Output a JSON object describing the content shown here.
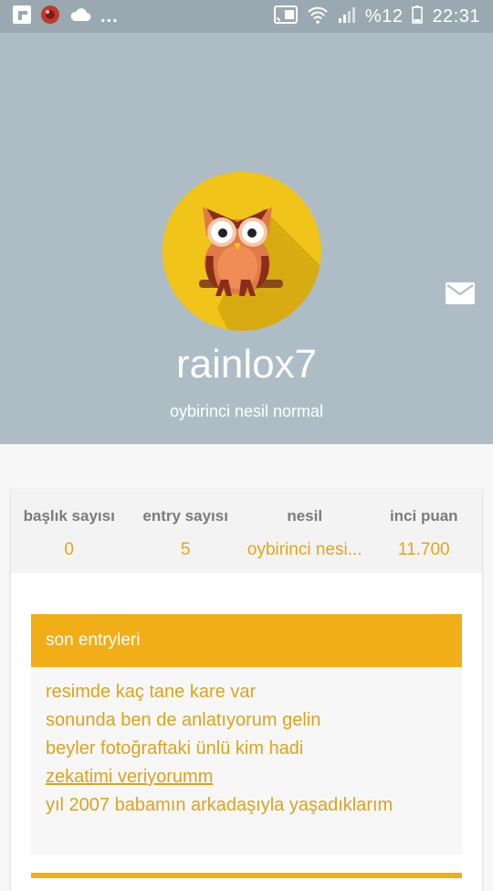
{
  "status_bar": {
    "battery_percent": "%12",
    "time": "22:31",
    "overflow": "..."
  },
  "profile": {
    "username": "rainlox7",
    "generation": "oybirinci nesil normal",
    "avatar": "owl-avatar",
    "colors": {
      "header_bg": "#aebdc5",
      "accent": "#f2ae17",
      "avatar_bg": "#f0c419"
    }
  },
  "stats": [
    {
      "label": "başlık sayısı",
      "value": "0"
    },
    {
      "label": "entry sayısı",
      "value": "5"
    },
    {
      "label": "nesil",
      "value": "oybirinci nesi..."
    },
    {
      "label": "inci puan",
      "value": "11.700"
    }
  ],
  "recent_entries": {
    "title": "son entryleri",
    "items": [
      "resimde kaç tane kare var",
      "sonunda ben de anlatıyorum gelin",
      "beyler fotoğraftaki ünlü kim hadi",
      "zekatimi veriyorumm",
      "yıl 2007 babamın arkadaşıyla yaşadıklarım"
    ]
  }
}
